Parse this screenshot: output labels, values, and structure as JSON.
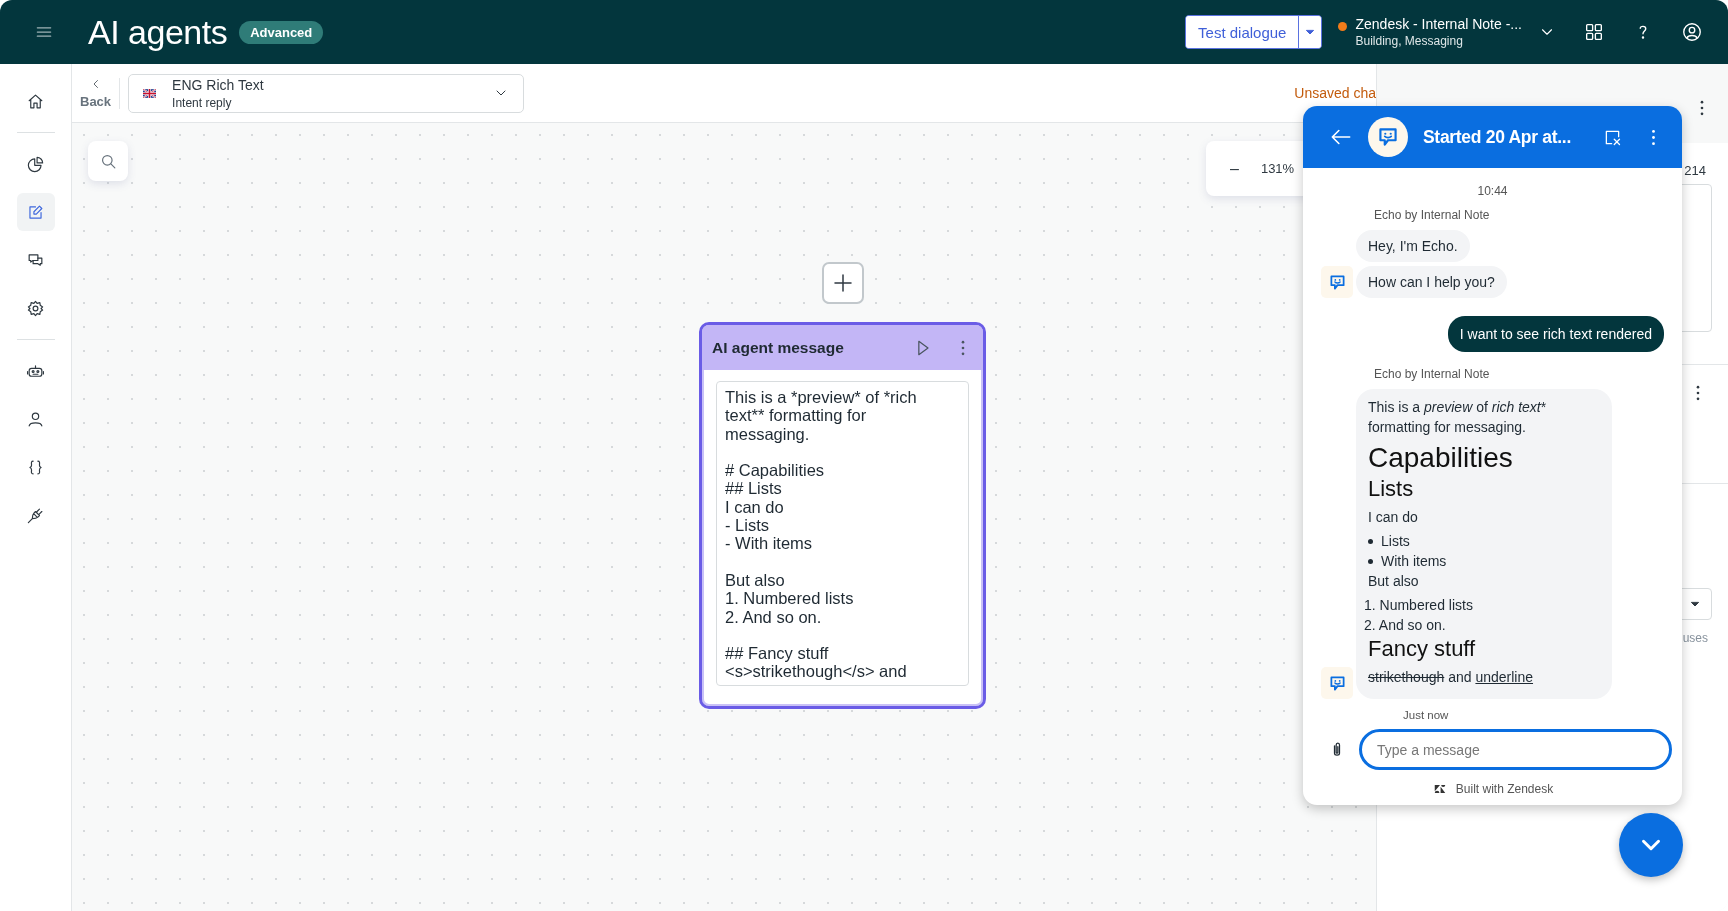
{
  "top_bar": {
    "title": "AI agents",
    "badge": "Advanced",
    "test_button": {
      "label": "Test dialogue"
    },
    "workspace": {
      "name": "Zendesk - Internal Note -...",
      "subtitle": "Building, Messaging"
    }
  },
  "nav": {
    "sections": [
      {
        "items": [
          {
            "kind": "home",
            "selected": false
          }
        ]
      },
      {
        "items": [
          {
            "kind": "chart",
            "selected": false
          },
          {
            "kind": "edit",
            "selected": true
          },
          {
            "kind": "chats",
            "selected": false
          },
          {
            "kind": "gear",
            "selected": false
          }
        ]
      },
      {
        "items": [
          {
            "kind": "robot",
            "selected": false
          },
          {
            "kind": "person",
            "selected": false
          },
          {
            "kind": "braces",
            "selected": false
          },
          {
            "kind": "plug",
            "selected": false
          }
        ]
      }
    ]
  },
  "subheader": {
    "back": "Back",
    "flow_select": {
      "title": "ENG Rich Text",
      "subtitle": "Intent reply"
    },
    "unsaved": "Unsaved cha"
  },
  "canvas": {
    "zoom": {
      "minus": "–",
      "value": "131%"
    },
    "node": {
      "title": "AI agent message",
      "text": "This is a *preview* of *rich text** formatting for messaging.\n\n# Capabilities\n## Lists\nI can do\n- Lists\n- With items\n\nBut also\n1. Numbered lists\n2. And so on.\n\n## Fancy stuff\n<s>strikethough</s> and"
    }
  },
  "details_panel": {
    "count": "214",
    "hint": "uses"
  },
  "chat": {
    "title": "Started 20 Apr at...",
    "time": "10:44",
    "groups": [
      {
        "kind": "agent",
        "sender": "Echo by Internal Note",
        "messages": [
          {
            "kind": "text",
            "text": "Hey, I'm Echo."
          },
          {
            "kind": "text",
            "text": "How can I help you?"
          }
        ]
      },
      {
        "kind": "user",
        "messages": [
          {
            "kind": "text",
            "text": "I want to see rich text rendered"
          }
        ]
      },
      {
        "kind": "agent",
        "sender": "Echo by Internal Note",
        "status": "Just now",
        "messages": [
          {
            "kind": "rich",
            "blocks": [
              {
                "kind": "paragraph",
                "segments": [
                  {
                    "kind": "plain",
                    "text": "This is a "
                  },
                  {
                    "kind": "italic",
                    "text": "preview"
                  },
                  {
                    "kind": "plain",
                    "text": " of "
                  },
                  {
                    "kind": "italic",
                    "text": "rich text"
                  },
                  {
                    "kind": "plain",
                    "text": "* formatting for messaging."
                  }
                ]
              },
              {
                "kind": "h1",
                "text": "Capabilities"
              },
              {
                "kind": "h2",
                "text": "Lists"
              },
              {
                "kind": "paragraph",
                "segments": [
                  {
                    "kind": "plain",
                    "text": "I can do"
                  }
                ]
              },
              {
                "kind": "bullets",
                "items": [
                  "Lists",
                  "With items"
                ]
              },
              {
                "kind": "paragraph",
                "segments": [
                  {
                    "kind": "plain",
                    "text": "But also"
                  }
                ]
              },
              {
                "kind": "numbered",
                "items": [
                  "1. Numbered lists",
                  "2. And so on."
                ]
              },
              {
                "kind": "h2",
                "text": "Fancy stuff"
              },
              {
                "kind": "paragraph",
                "segments": [
                  {
                    "kind": "strike",
                    "text": "strikethough"
                  },
                  {
                    "kind": "plain",
                    "text": " and "
                  },
                  {
                    "kind": "underline",
                    "text": "underline"
                  }
                ]
              }
            ]
          }
        ]
      }
    ],
    "input": {
      "placeholder": "Type a message"
    },
    "footer": "Built with Zendesk"
  }
}
